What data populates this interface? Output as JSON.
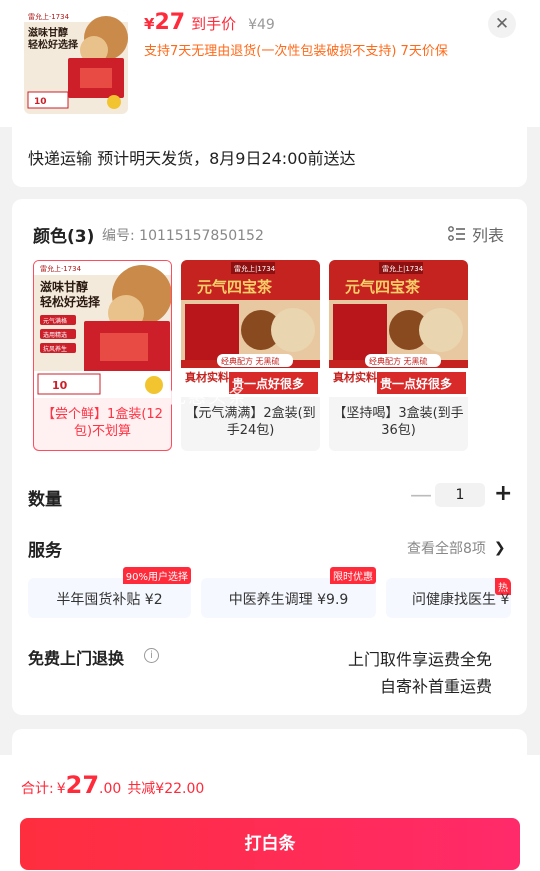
{
  "header": {
    "price_symbol": "¥",
    "price_value": "27",
    "price_tag": "到手价",
    "original_price": "¥49",
    "return_note": "支持7天无理由退货(一次性包装破损不支持) 7天价保",
    "thumb": {
      "brand": "雷允上·1734",
      "slogan_line1": "滋味甘醇",
      "slogan_line2": "轻松好选择",
      "count": "10"
    }
  },
  "shipping": {
    "text": "快递运输 预计明天发货，8月9日24:00前送达"
  },
  "color_section": {
    "title": "颜色(3)",
    "sku": "编号: 10115157850152",
    "list_toggle": "列表",
    "variants": [
      {
        "label": "【尝个鲜】1盒装(12包)不划算",
        "selected": true,
        "img_brand": "雷允上·1734",
        "img_line1": "滋味甘醇",
        "img_line2": "轻松好选择",
        "img_points": [
          "元气满格",
          "选用精选",
          "抗风养生"
        ],
        "img_count": "10"
      },
      {
        "label": "【元气满满】2盒装(到手24包)",
        "selected": false,
        "img_brand": "雷允上|1734",
        "img_title": "元气四宝茶",
        "img_sub": "经典配方 无黑硫",
        "img_tag": "真材实料",
        "img_slogan": "贵一点好很多"
      },
      {
        "label": "【坚持喝】3盒装(到手36包)",
        "selected": false,
        "img_brand": "雷允上|1734",
        "img_title": "元气四宝茶",
        "img_sub": "经典配方 无黑硫",
        "img_tag": "真材实料",
        "img_slogan": "贵一点好很多"
      }
    ],
    "watermark": "优惠头条"
  },
  "quantity": {
    "label": "数量",
    "value": "1",
    "minus": "—",
    "plus": "+"
  },
  "service": {
    "label": "服务",
    "view_all": "查看全部8项",
    "chips": [
      {
        "text": "半年囤货补贴 ¥2",
        "badge": "90%用户选择"
      },
      {
        "text": "中医养生调理 ¥9.9",
        "badge": "限时优惠"
      },
      {
        "text": "问健康找医生 ¥",
        "badge": "热"
      }
    ]
  },
  "returns": {
    "label": "免费上门退换",
    "line1": "上门取件享运费全免",
    "line2": "自寄补首重运费"
  },
  "footer": {
    "total_label": "合计:",
    "total_symbol": "¥",
    "total_int": "27",
    "total_dec": ".00",
    "savings": "共减¥22.00",
    "pay_button": "打白条"
  },
  "colors": {
    "accent": "#ff2a3a",
    "orange": "#ff6a1a"
  }
}
